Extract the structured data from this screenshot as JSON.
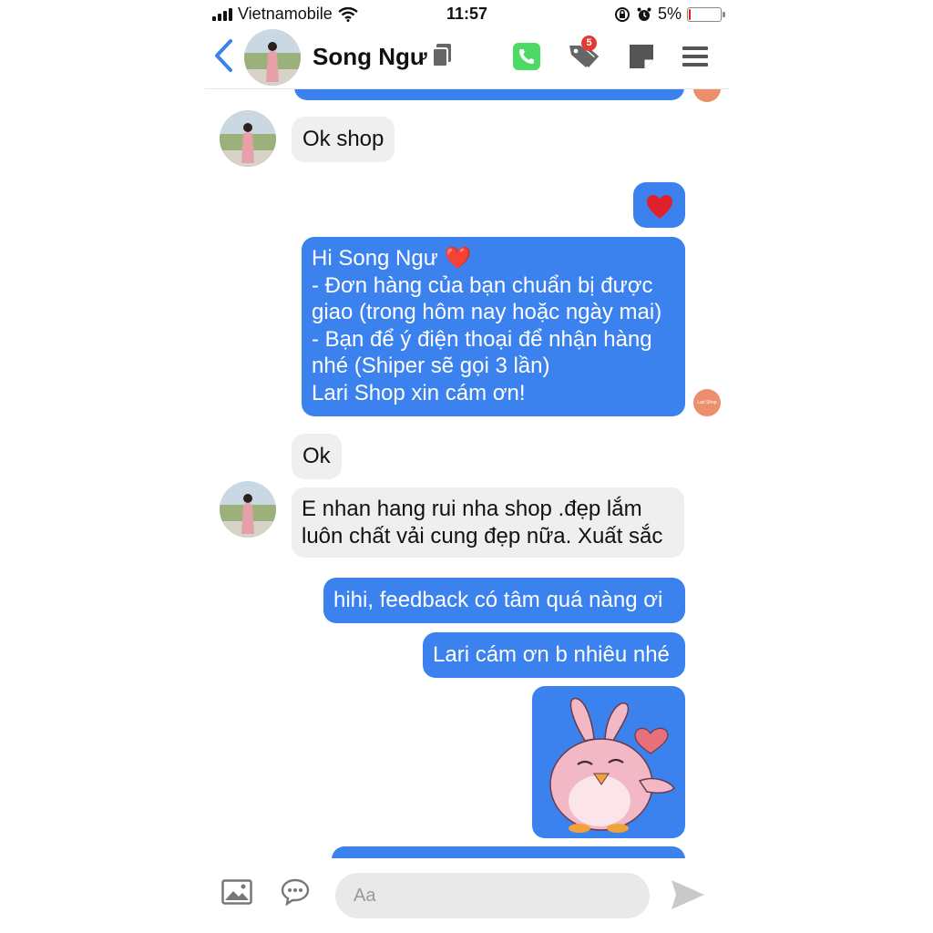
{
  "status": {
    "carrier": "Vietnamobile",
    "time": "11:57",
    "battery": "5%",
    "battery_level": 0.05,
    "battery_color": "#e02020"
  },
  "header": {
    "contact_name": "Song Ngư",
    "notification_count": "5",
    "icons": [
      "back-chevron-icon",
      "copy-icon",
      "phone-icon",
      "tags-icon",
      "note-icon",
      "menu-icon"
    ]
  },
  "messages": [
    {
      "from": "contact",
      "text": "Ok shop"
    },
    {
      "from": "me",
      "text": "❤️"
    },
    {
      "from": "me",
      "lines": [
        "Hi Song Ngư ❤️",
        "- Đơn hàng của bạn chuẩn bị được",
        "giao (trong hôm nay hoặc ngày mai)",
        "- Bạn để ý điện thoại để nhận hàng",
        "nhé (Shiper sẽ gọi 3 lần)",
        "Lari Shop xin cám ơn!"
      ]
    },
    {
      "from": "contact",
      "text": "Ok"
    },
    {
      "from": "contact",
      "lines": [
        "E nhan hang rui nha shop .đẹp lắm",
        "luôn chất vải cung đẹp nữa. Xuất sắc"
      ]
    },
    {
      "from": "me",
      "text": "hihi, feedback có tâm quá nàng ơi"
    },
    {
      "from": "me",
      "text": "Lari cám ơn b nhiêu nhé"
    },
    {
      "from": "me",
      "sticker": "pink-bird-blowing-kiss-sticker"
    }
  ],
  "shop_avatar_label": "Lari Shop",
  "composer": {
    "placeholder": "Aa",
    "icons": [
      "image-icon",
      "chat-bubble-icon",
      "send-icon"
    ]
  },
  "colors": {
    "outgoing_bubble": "#3b82ef",
    "incoming_bubble": "#efefef",
    "accent": "#3b82ef",
    "call_green": "#4cd964",
    "badge_red": "#e53935"
  }
}
